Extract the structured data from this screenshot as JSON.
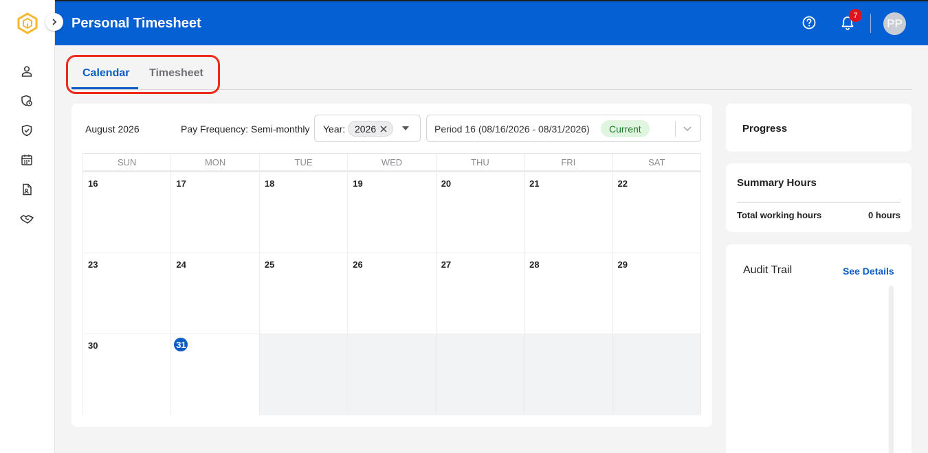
{
  "header": {
    "title": "Personal Timesheet",
    "notification_count": "7",
    "avatar_initials": "PP"
  },
  "colors": {
    "header_bg": "#0560d3",
    "accent": "#0e5cc4",
    "badge": "#e0131d",
    "current_chip_bg": "#dff5e0",
    "current_chip_text": "#1f7a26",
    "highlight_outline": "#ee2a1d"
  },
  "sidebar": {
    "items": [
      {
        "icon": "user-icon"
      },
      {
        "icon": "shield-clock-icon"
      },
      {
        "icon": "shield-check-icon"
      },
      {
        "icon": "calendar-icon"
      },
      {
        "icon": "document-user-icon"
      },
      {
        "icon": "handshake-icon"
      }
    ]
  },
  "tabs": [
    {
      "label": "Calendar",
      "active": true
    },
    {
      "label": "Timesheet",
      "active": false
    }
  ],
  "toolbar": {
    "month_label": "August 2026",
    "pay_frequency": "Pay Frequency: Semi-monthly",
    "year_label": "Year:",
    "year_value": "2026",
    "period_value": "Period 16 (08/16/2026 - 08/31/2026)",
    "period_status": "Current"
  },
  "calendar": {
    "weekdays": [
      "SUN",
      "MON",
      "TUE",
      "WED",
      "THU",
      "FRI",
      "SAT"
    ],
    "weeks": [
      [
        "16",
        "17",
        "18",
        "19",
        "20",
        "21",
        "22"
      ],
      [
        "23",
        "24",
        "25",
        "26",
        "27",
        "28",
        "29"
      ],
      [
        "30",
        "31",
        "",
        "",
        "",
        "",
        ""
      ]
    ],
    "today": "31"
  },
  "progress": {
    "title": "Progress"
  },
  "summary": {
    "title": "Summary Hours",
    "row_label": "Total working hours",
    "row_value": "0 hours"
  },
  "audit": {
    "title": "Audit Trail",
    "link": "See Details"
  }
}
